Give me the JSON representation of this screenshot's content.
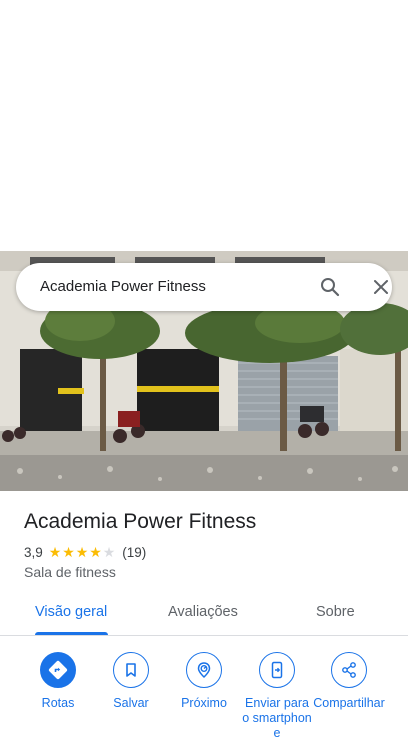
{
  "search": {
    "query": "Academia Power Fitness"
  },
  "place": {
    "name": "Academia Power Fitness",
    "rating": "3,9",
    "stars": 3.9,
    "reviews": "(19)",
    "category": "Sala de fitness"
  },
  "tabs": [
    {
      "label": "Visão geral",
      "active": true
    },
    {
      "label": "Avaliações",
      "active": false
    },
    {
      "label": "Sobre",
      "active": false
    }
  ],
  "actions": [
    {
      "label": "Rotas",
      "icon": "directions-icon"
    },
    {
      "label": "Salvar",
      "icon": "bookmark-icon"
    },
    {
      "label": "Próximo",
      "icon": "nearby-icon"
    },
    {
      "label": "Enviar para o smartphone",
      "icon": "send-to-phone-icon"
    },
    {
      "label": "Compartilhar",
      "icon": "share-icon"
    }
  ],
  "colors": {
    "accent": "#1a73e8",
    "star": "#fbbc04"
  }
}
